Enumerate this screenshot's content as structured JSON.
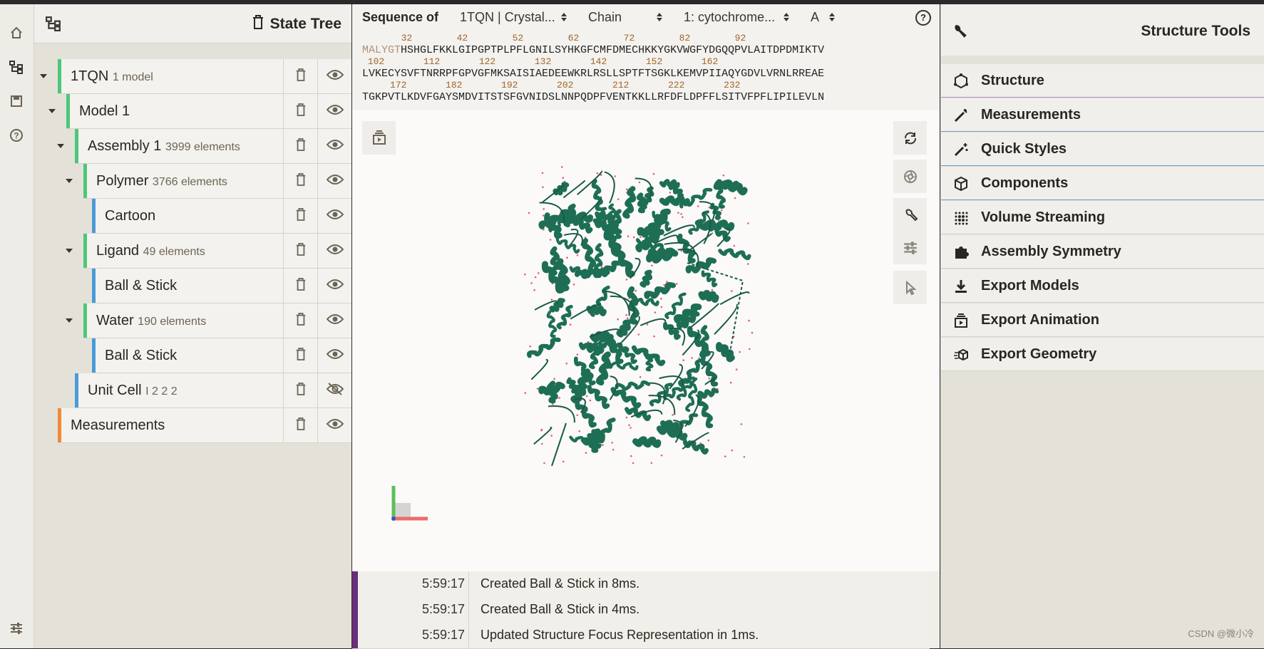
{
  "state_tree": {
    "title": "State Tree",
    "nodes": [
      {
        "label": "1TQN",
        "sub": "1 model",
        "color": "#4cc77a",
        "visible": true
      },
      {
        "label": "Model 1",
        "sub": "",
        "color": "#4cc77a",
        "visible": true
      },
      {
        "label": "Assembly 1",
        "sub": "3999 elements",
        "color": "#4cc77a",
        "visible": true
      },
      {
        "label": "Polymer",
        "sub": "3766 elements",
        "color": "#4cc77a",
        "visible": true
      },
      {
        "label": "Cartoon",
        "sub": "",
        "color": "#4a9bd8",
        "visible": true
      },
      {
        "label": "Ligand",
        "sub": "49 elements",
        "color": "#4cc77a",
        "visible": true
      },
      {
        "label": "Ball & Stick",
        "sub": "",
        "color": "#4a9bd8",
        "visible": true
      },
      {
        "label": "Water",
        "sub": "190 elements",
        "color": "#4cc77a",
        "visible": true
      },
      {
        "label": "Ball & Stick",
        "sub": "",
        "color": "#4a9bd8",
        "visible": true
      },
      {
        "label": "Unit Cell",
        "sub": "I 2 2 2",
        "color": "#4a9bd8",
        "visible": false
      },
      {
        "label": "Measurements",
        "sub": "",
        "color": "#f08a3a",
        "visible": true
      }
    ]
  },
  "sequence": {
    "label": "Sequence of",
    "structure": "1TQN | Crystal...",
    "mode": "Chain",
    "entity": "1: cytochrome...",
    "chain": "A",
    "lines": [
      {
        "nums": "       32        42        52        62        72        82        92",
        "prefix": "MALYGT",
        "seq": "HSHGLFKKLGIPGPTPLPFLGNILSYHKGFCMFDMECHKKYGKVWGFYDGQQPVLAITDPDMIKTV"
      },
      {
        "nums": " 102       112       122       132       142       152       162",
        "prefix": "",
        "seq": "LVKECYSVFTNRRPFGPVGFMKSAISIAEDEEWKRLRSLLSPTFTSGKLKEMVPIIAQYGDVLVRNLRREAE"
      },
      {
        "nums": "     172       182       192       202       212       222       232",
        "prefix": "",
        "seq": "TGKPVTLKDVFGAYSMDVITSTSFGVNIDSLNNPQDPFVENTKKLLRFDFLDPFFLSITVFPFLIPILEVLN"
      }
    ]
  },
  "log": [
    {
      "time": "5:59:17",
      "message": "Created Ball & Stick in 8ms."
    },
    {
      "time": "5:59:17",
      "message": "Created Ball & Stick in 4ms."
    },
    {
      "time": "5:59:17",
      "message": "Updated Structure Focus Representation in 1ms."
    }
  ],
  "tools": {
    "title": "Structure Tools",
    "items": [
      {
        "label": "Structure",
        "icon": "structure-icon"
      },
      {
        "label": "Measurements",
        "icon": "measurements-icon"
      },
      {
        "label": "Quick Styles",
        "icon": "magic-wand-icon"
      },
      {
        "label": "Components",
        "icon": "cube-icon"
      },
      {
        "label": "Volume Streaming",
        "icon": "grid-dots-icon"
      },
      {
        "label": "Assembly Symmetry",
        "icon": "puzzle-icon"
      },
      {
        "label": "Export Models",
        "icon": "download-icon"
      },
      {
        "label": "Export Animation",
        "icon": "animation-icon"
      },
      {
        "label": "Export Geometry",
        "icon": "geometry-icon"
      }
    ]
  },
  "watermark": "CSDN @微小冷",
  "colors": {
    "protein": "#1e6e55",
    "water": "#e0607a",
    "accent_log": "#6a2e7a"
  }
}
